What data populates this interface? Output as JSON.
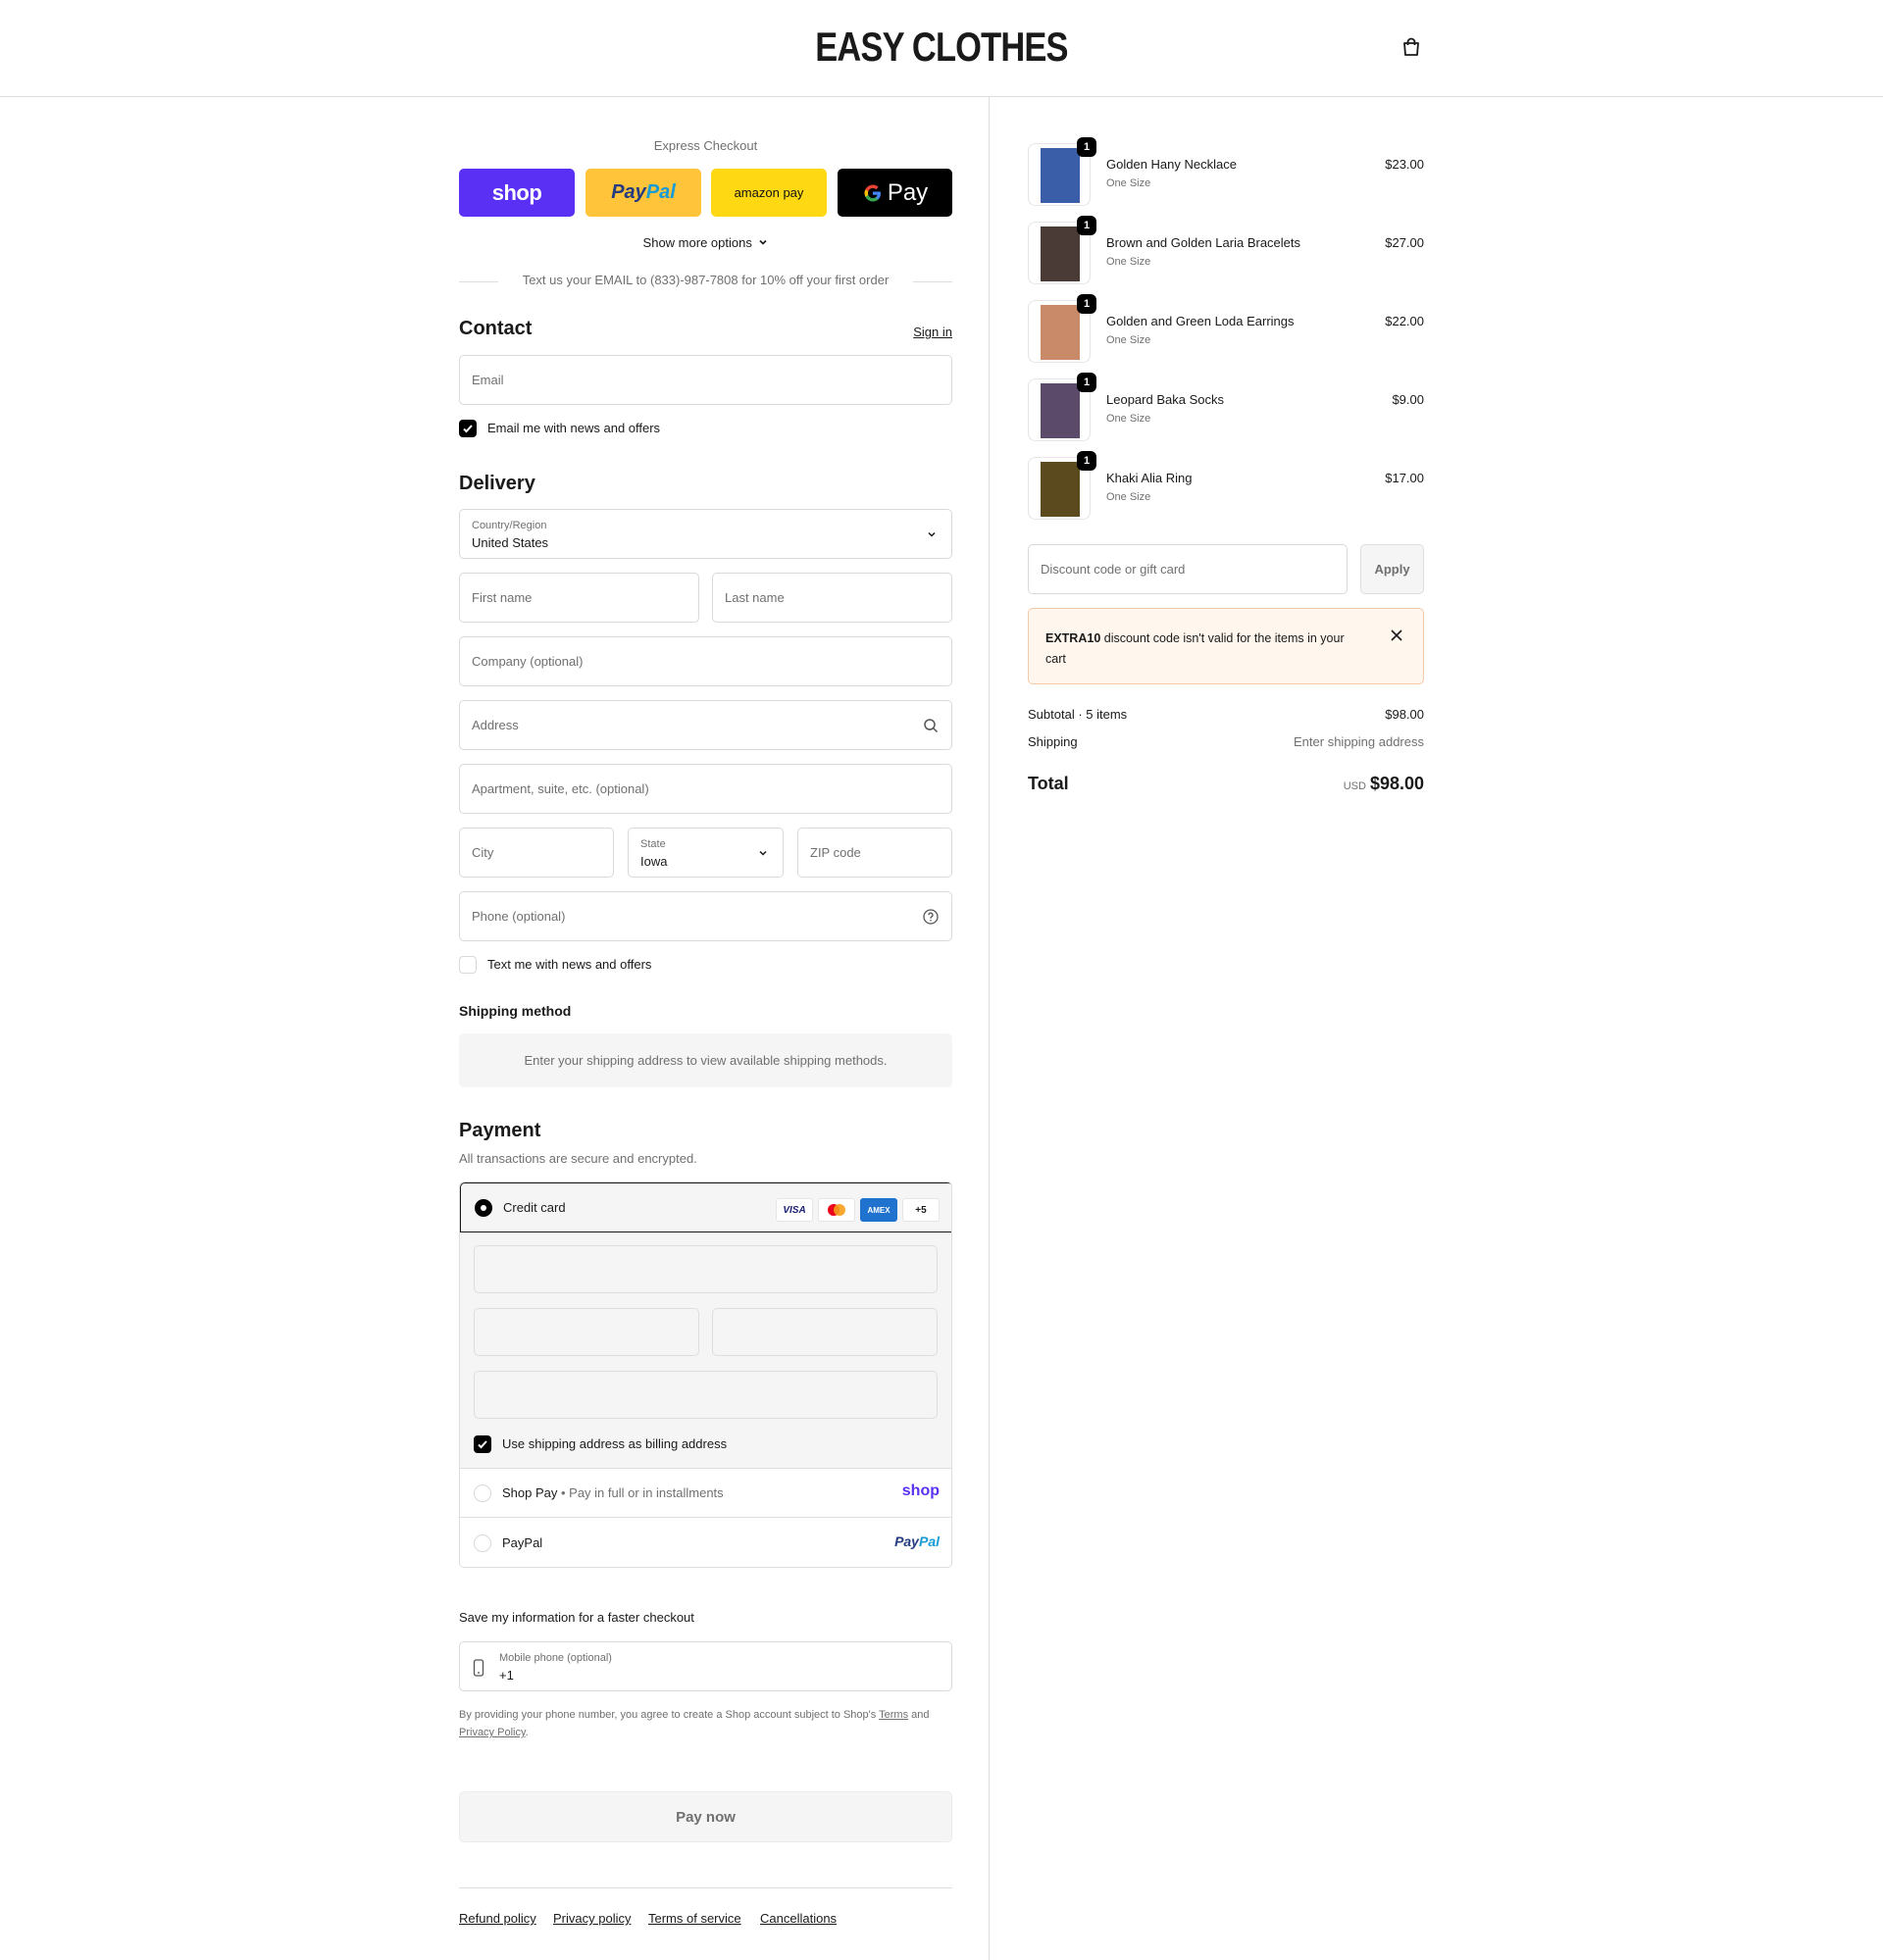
{
  "header": {
    "brand": "EASY CLOTHES"
  },
  "express": {
    "title": "Express Checkout",
    "shop_label": "shop",
    "paypal_label_1": "Pay",
    "paypal_label_2": "Pal",
    "amazon_label": "amazon pay",
    "gpay_label": "Pay",
    "show_more": "Show more options",
    "promo_text": "Text us your EMAIL to (833)-987-7808 for 10% off your first order"
  },
  "contact": {
    "heading": "Contact",
    "sign_in": "Sign in",
    "email_placeholder": "Email",
    "news_label": "Email me with news and offers",
    "news_checked": true
  },
  "delivery": {
    "heading": "Delivery",
    "country_label": "Country/Region",
    "country_value": "United States",
    "first_name_placeholder": "First name",
    "last_name_placeholder": "Last name",
    "company_placeholder": "Company (optional)",
    "address_placeholder": "Address",
    "apartment_placeholder": "Apartment, suite, etc. (optional)",
    "city_placeholder": "City",
    "state_label": "State",
    "state_value": "Iowa",
    "zip_placeholder": "ZIP code",
    "phone_placeholder": "Phone (optional)",
    "text_news_label": "Text me with news and offers",
    "text_news_checked": false
  },
  "shipping_method": {
    "heading": "Shipping method",
    "message": "Enter your shipping address to view available shipping methods."
  },
  "payment": {
    "heading": "Payment",
    "subtitle": "All transactions are secure and encrypted.",
    "credit_card_label": "Credit card",
    "card_logos": [
      "VISA",
      "MC",
      "AMEX",
      "+5"
    ],
    "billing_same_label": "Use shipping address as billing address",
    "billing_same_checked": true,
    "shop_pay_label": "Shop Pay",
    "shop_pay_sub": "Pay in full or in installments",
    "shop_pay_logo": "shop",
    "paypal_label": "PayPal",
    "paypal_logo_1": "Pay",
    "paypal_logo_2": "Pal"
  },
  "save_info": {
    "heading": "Save my information for a faster checkout",
    "mobile_label": "Mobile phone (optional)",
    "mobile_value": "+1",
    "fine_print_1": "By providing your phone number, you agree to create a Shop account subject to Shop's",
    "terms": "Terms",
    "and": "and",
    "privacy": "Privacy Policy",
    "period": "."
  },
  "pay_now": "Pay now",
  "footer_links": [
    "Refund policy",
    "Privacy policy",
    "Terms of service",
    "Cancellations"
  ],
  "order": {
    "items": [
      {
        "name": "Golden Hany Necklace",
        "variant": "One Size",
        "price": "$23.00",
        "qty": "1",
        "color": "#3a5fa8"
      },
      {
        "name": "Brown and Golden Laria Bracelets",
        "variant": "One Size",
        "price": "$27.00",
        "qty": "1",
        "color": "#4a3b36"
      },
      {
        "name": "Golden and Green Loda Earrings",
        "variant": "One Size",
        "price": "$22.00",
        "qty": "1",
        "color": "#c98a6a"
      },
      {
        "name": "Leopard Baka Socks",
        "variant": "One Size",
        "price": "$9.00",
        "qty": "1",
        "color": "#5b4a6a"
      },
      {
        "name": "Khaki Alia Ring",
        "variant": "One Size",
        "price": "$17.00",
        "qty": "1",
        "color": "#5a4a1e"
      }
    ],
    "discount_placeholder": "Discount code or gift card",
    "apply_label": "Apply",
    "warning_code": "EXTRA10",
    "warning_text": " discount code isn't valid for the items in your cart",
    "subtotal_label": "Subtotal · 5 items",
    "subtotal_value": "$98.00",
    "shipping_label": "Shipping",
    "shipping_value": "Enter shipping address",
    "total_label": "Total",
    "currency": "USD",
    "total_value": "$98.00"
  },
  "colors": {
    "shop_purple": "#5a31f4",
    "paypal_yellow": "#ffc439",
    "amazon_yellow": "#ffd814",
    "warning_bg": "#fff6ee"
  }
}
